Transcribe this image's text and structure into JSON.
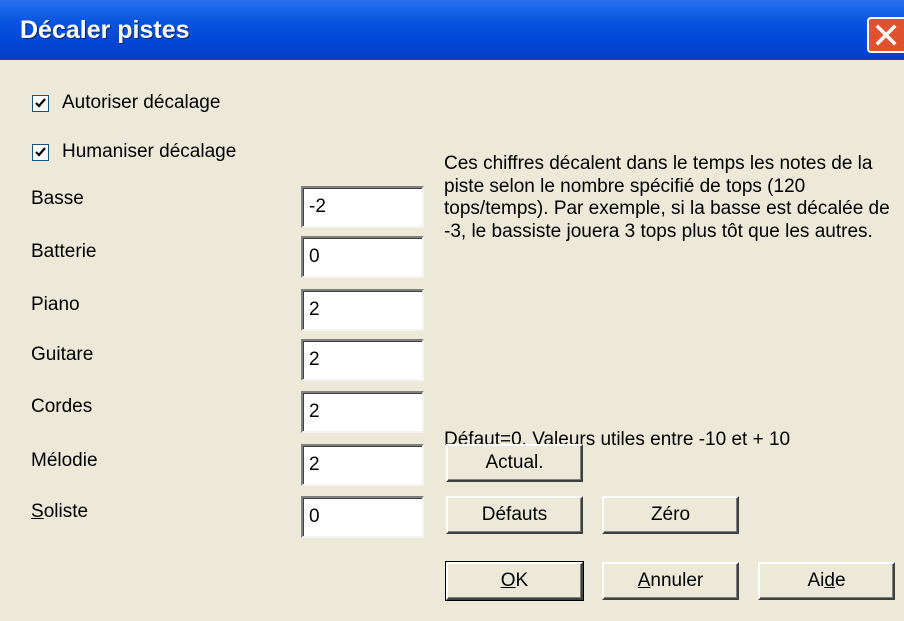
{
  "window": {
    "title": "Décaler pistes"
  },
  "options": {
    "auto_shift": {
      "label": "Autoriser décalage",
      "checked": true
    },
    "humanize": {
      "label": "Humaniser décalage",
      "checked": true
    }
  },
  "tracks": [
    {
      "label": "Basse",
      "value": "-2"
    },
    {
      "label": "Batterie",
      "value": "0"
    },
    {
      "label": "Piano",
      "value": "2"
    },
    {
      "label": "Guitare",
      "value": "2"
    },
    {
      "label": "Cordes",
      "value": "2"
    },
    {
      "label": "Mélodie",
      "value": "2"
    },
    {
      "label_pre": "",
      "label_ul": "S",
      "label_post": "oliste",
      "value": "0"
    }
  ],
  "help": {
    "description": "Ces chiffres décalent dans le temps les notes de la piste selon le nombre spécifié de tops (120 tops/temps). Par exemple, si la basse est décalée de -3, le bassiste jouera 3 tops plus tôt que les autres.",
    "default_note": "Défaut=0. Valeurs utiles entre -10 et + 10"
  },
  "buttons": {
    "actual": "Actual.",
    "defaults": "Défauts",
    "zero": "Zéro",
    "ok": {
      "ul": "O",
      "rest": "K"
    },
    "cancel": {
      "ul": "A",
      "rest": "nnuler"
    },
    "help": {
      "pre": "Ai",
      "ul": "d",
      "post": "e"
    }
  }
}
